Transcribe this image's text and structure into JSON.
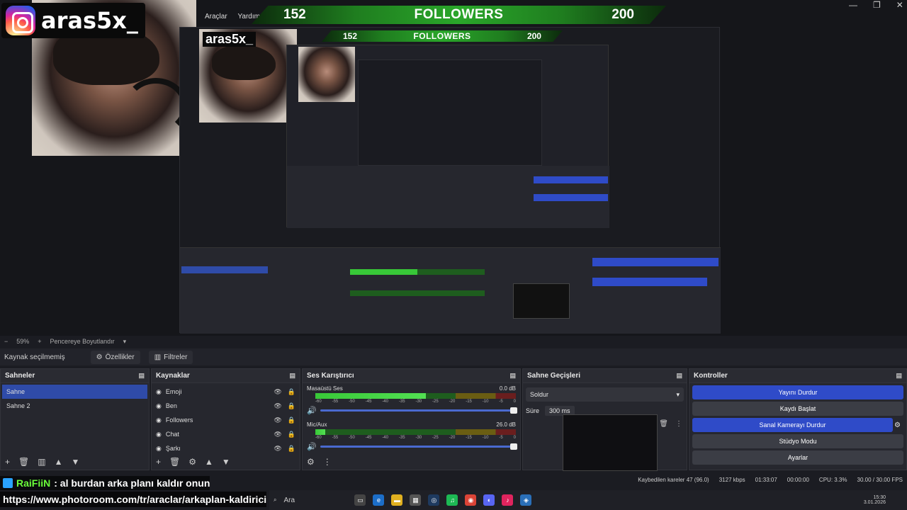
{
  "stream": {
    "username": "aras5x_",
    "followers_current": "152",
    "followers_label": "FOLLOWERS",
    "followers_goal": "200"
  },
  "menu": {
    "item1": "Araçlar",
    "item2": "Yardım"
  },
  "preview_bar": {
    "zoom": "59%",
    "minus": "−",
    "plus": "+",
    "fit_label": "Pencereye Boyutlandır"
  },
  "source_bar": {
    "selected": "Kaynak seçilmemiş",
    "properties": "Özellikler",
    "filters": "Filtreler"
  },
  "scenes": {
    "title": "Sahneler",
    "items": [
      "Sahne",
      "Sahne 2"
    ]
  },
  "sources": {
    "title": "Kaynaklar",
    "items": [
      "Emoji",
      "Ben",
      "Followers",
      "Chat",
      "Şarkı"
    ]
  },
  "mixer": {
    "title": "Ses Karıştırıcı",
    "channels": [
      {
        "name": "Masaüstü Ses",
        "db": "0.0 dB",
        "level": 0.55
      },
      {
        "name": "Mic/Aux",
        "db": "26.0 dB",
        "level": 0.05
      }
    ],
    "scale": [
      "-60",
      "-55",
      "-50",
      "-45",
      "-40",
      "-35",
      "-30",
      "-25",
      "-20",
      "-15",
      "-10",
      "-5",
      "0"
    ]
  },
  "transitions": {
    "title": "Sahne Geçişleri",
    "selected": "Soldur",
    "duration_label": "Süre",
    "duration": "300 ms"
  },
  "controls": {
    "title": "Kontroller",
    "buttons": [
      "Yayını Durdur",
      "Kaydı Başlat",
      "Sanal Kamerayı Durdur",
      "Stüdyo Modu",
      "Ayarlar"
    ]
  },
  "status": {
    "dropped_frames": "Kaybedilen kareler 47 (96.0)",
    "bitrate": "3127 kbps",
    "stream_time": "01:33:07",
    "rec_time": "00:00:00",
    "cpu": "CPU: 3.3%",
    "fps": "30.00 / 30.00 FPS"
  },
  "chat": {
    "user": "RaiFiiN",
    "message": ": al burdan arka planı kaldır onun",
    "link": "https://www.photoroom.com/tr/araclar/arkaplan-kaldirici"
  },
  "taskbar": {
    "search": "Ara",
    "time": "15:30",
    "date": "3.01.2026"
  },
  "colors": {
    "accent_blue": "#2f4bc8",
    "followers_green": "#2aa62a",
    "chat_user": "#6bff3b"
  }
}
